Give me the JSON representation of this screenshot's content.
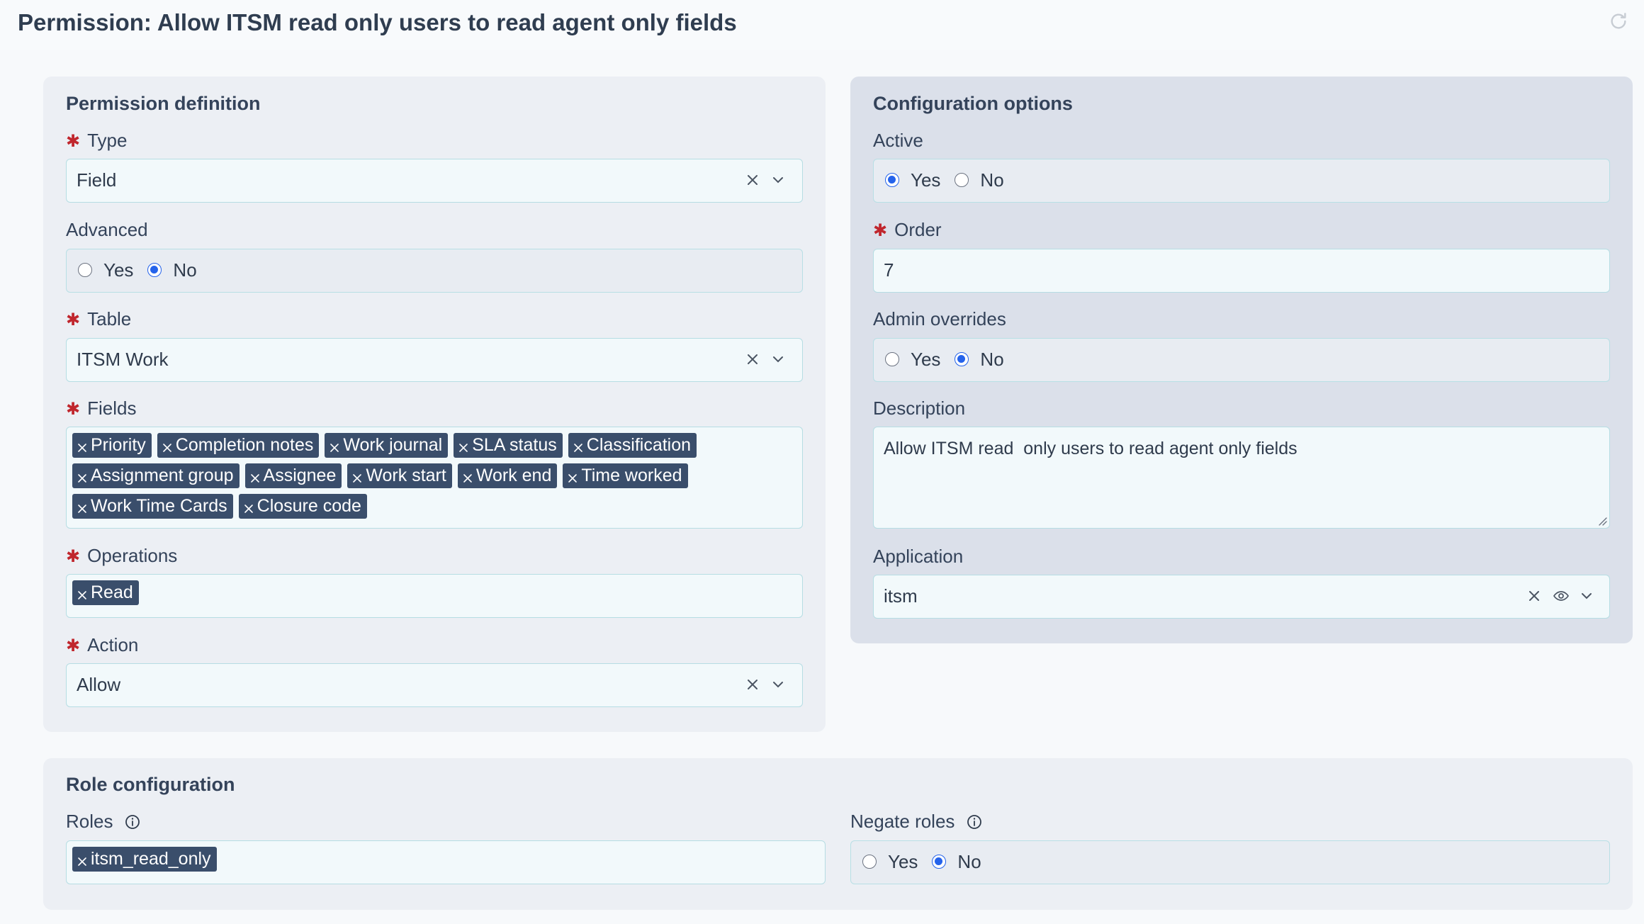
{
  "title": "Permission: Allow ITSM read only users to read agent only fields",
  "definition": {
    "heading": "Permission definition",
    "type": {
      "label": "Type",
      "value": "Field"
    },
    "advanced": {
      "label": "Advanced",
      "yes": "Yes",
      "no": "No",
      "selected": "No"
    },
    "table": {
      "label": "Table",
      "value": "ITSM Work"
    },
    "fields": {
      "label": "Fields",
      "tags": [
        "Priority",
        "Completion notes",
        "Work journal",
        "SLA status",
        "Classification",
        "Assignment group",
        "Assignee",
        "Work start",
        "Work end",
        "Time worked",
        "Work Time Cards",
        "Closure code"
      ]
    },
    "operations": {
      "label": "Operations",
      "tags": [
        "Read"
      ]
    },
    "action": {
      "label": "Action",
      "value": "Allow"
    }
  },
  "config": {
    "heading": "Configuration options",
    "active": {
      "label": "Active",
      "yes": "Yes",
      "no": "No",
      "selected": "Yes"
    },
    "order": {
      "label": "Order",
      "value": "7"
    },
    "admin_overrides": {
      "label": "Admin overrides",
      "yes": "Yes",
      "no": "No",
      "selected": "No"
    },
    "description": {
      "label": "Description",
      "value": "Allow ITSM read  only users to read agent only fields"
    },
    "application": {
      "label": "Application",
      "value": "itsm"
    }
  },
  "roles": {
    "heading": "Role configuration",
    "roles": {
      "label": "Roles",
      "tags": [
        "itsm_read_only"
      ]
    },
    "negate": {
      "label": "Negate roles",
      "yes": "Yes",
      "no": "No",
      "selected": "No"
    }
  },
  "icons": {
    "required": "asterisk-icon",
    "clear": "close-icon",
    "dropdown": "chevron-down-icon",
    "info": "info-icon",
    "refresh": "refresh-icon",
    "preview": "eye-icon"
  },
  "colors": {
    "tag_bg": "#3a4e6b",
    "radio_selected": "#2563eb",
    "required": "#c0262d",
    "input_border": "#b6dde3"
  }
}
